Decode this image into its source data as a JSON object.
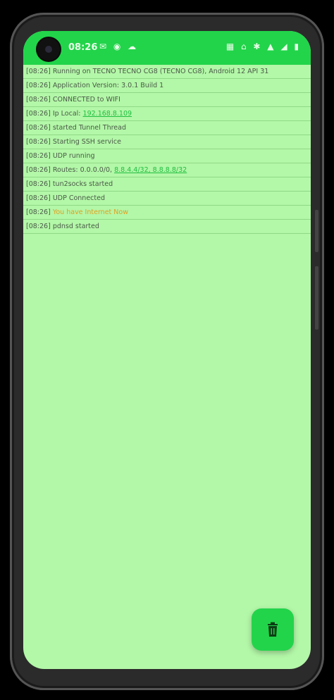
{
  "status_bar": {
    "time": "08:26",
    "left_icons": "✉ ◉ ☁",
    "right_icons": "▦ ⌂ ✱ ▲ ◢ ▮"
  },
  "log_lines": [
    {
      "time": "[08:26]",
      "text": "Running on TECNO TECNO CG8 (TECNO CG8), Android 12 API 31"
    },
    {
      "time": "[08:26]",
      "text": "Application Version: 3.0.1 Build 1"
    },
    {
      "time": "[08:26]",
      "text": "CONNECTED to WIFI"
    },
    {
      "time": "[08:26]",
      "text": "Ip Local:",
      "link": "192.168.8.109"
    },
    {
      "time": "[08:26]",
      "text": "started Tunnel Thread"
    },
    {
      "time": "[08:26]",
      "text": "Starting SSH service"
    },
    {
      "time": "[08:26]",
      "text": "UDP running"
    },
    {
      "time": "[08:26]",
      "text": "Routes: 0.0.0.0/0,",
      "link": "8.8.4.4/32, 8.8.8.8/32"
    },
    {
      "time": "[08:26]",
      "text": "tun2socks started"
    },
    {
      "time": "[08:26]",
      "text": "UDP Connected"
    },
    {
      "time": "[08:26]",
      "warn": "You have Internet Now"
    },
    {
      "time": "[08:26]",
      "text": "pdnsd started"
    }
  ],
  "fab": {
    "icon": "clear-log-icon"
  },
  "colors": {
    "accent": "#22d44a",
    "background": "#b3f7a8",
    "link": "#1fbf3f",
    "warning": "#e0a020"
  }
}
